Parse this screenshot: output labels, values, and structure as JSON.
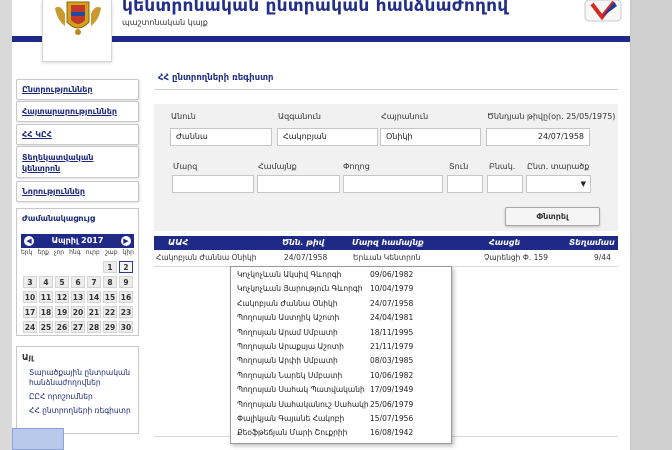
{
  "header": {
    "title": "կենտրոնական ընտրական հանձնաժողով",
    "subtitle": "պաշտոնական կայք"
  },
  "sidebar": {
    "nav": [
      "Ընտրություններ",
      "Հայտարարություններ",
      "ՀՀ ԿԸՀ",
      "Տեղեկատվական կենտրոն",
      "Նորություններ"
    ],
    "calendar": {
      "title": "Ժամանակացույց",
      "month": "Ապրիլ 2017",
      "days": [
        "երկ",
        "երք",
        "չոր",
        "հնգ",
        "ուրբ",
        "շաբ",
        "կիր"
      ],
      "rows": [
        [
          "",
          "",
          "",
          "",
          "",
          "1",
          "2"
        ],
        [
          "3",
          "4",
          "5",
          "6",
          "7",
          "8",
          "9"
        ],
        [
          "10",
          "11",
          "12",
          "13",
          "14",
          "15",
          "16"
        ],
        [
          "17",
          "18",
          "19",
          "20",
          "21",
          "22",
          "23"
        ],
        [
          "24",
          "25",
          "26",
          "27",
          "28",
          "29",
          "30"
        ]
      ],
      "today": "2"
    },
    "other": {
      "title": "Այլ",
      "links": [
        "Տարածքային ընտրական հանձնաժողովներ",
        "ԸԸՀ որոշումներ",
        "ՀՀ ընտրողների ռեգիստր"
      ]
    }
  },
  "content": {
    "title": "ՀՀ ընտրողների ռեգիստր",
    "form": {
      "labels": {
        "first_name": "Անուն",
        "last_name": "Ազգանուն",
        "patronymic": "Հայրանուն",
        "birth_date": "Ծննդյան թիվը(օր. 25/05/1975)",
        "region": "Մարզ",
        "community": "Համայնք",
        "street": "Փողոց",
        "house": "Տուն",
        "apartment": "Բնակ.",
        "precinct": "Ընտ. տարածք"
      },
      "values": {
        "first_name": "Ժաննա",
        "last_name": "Հակոբյան",
        "patronymic": "Օնիկի",
        "birth_date": "24/07/1958",
        "region": "",
        "community": "",
        "street": "",
        "house": "",
        "apartment": "",
        "precinct": ""
      },
      "search_label": "Փնտրել"
    },
    "table": {
      "headers": [
        "ԱԱՀ",
        "Ծնն. թիվ",
        "Մարզ համայնք",
        "Հասցե",
        "Տեղամաս"
      ],
      "row": [
        "Հակոբյան Ժաննա Օնիկի",
        "24/07/1958",
        "Երևան Կենտրոն",
        "Չարենցի Փ. 159",
        "9/44"
      ]
    },
    "dropdown": [
      {
        "name": "Կոչկոչևան Ակսիվ Գևորգի",
        "date": "09/06/1982"
      },
      {
        "name": "Կոչկոչևան Յարություն Գևորգի",
        "date": "10/04/1979"
      },
      {
        "name": "Հակոբյան Ժաննա Օնիկի",
        "date": "24/07/1958"
      },
      {
        "name": "Պողոսյան Աստղիկ Աշոտի",
        "date": "24/04/1981"
      },
      {
        "name": "Պողոսյան Արամ Սմբատի",
        "date": "18/11/1995"
      },
      {
        "name": "Պողոսյան Արաքսյա Աշոտի",
        "date": "21/11/1979"
      },
      {
        "name": "Պողոսյան Արփի Սմբատի",
        "date": "08/03/1985"
      },
      {
        "name": "Պողոսյան Նարեկ Սմբատի",
        "date": "10/06/1982"
      },
      {
        "name": "Պողոսյան Սահակ Պատվականի",
        "date": "17/09/1949"
      },
      {
        "name": "Պողոսյան Սահականուշ Սահակի",
        "date": "25/06/1979"
      },
      {
        "name": "Փալիկյան Գայանե Հակոբի",
        "date": "15/07/1956"
      },
      {
        "name": "Քեօֆթեճյան Մարի Շուքրիի",
        "date": "16/08/1942"
      }
    ]
  }
}
